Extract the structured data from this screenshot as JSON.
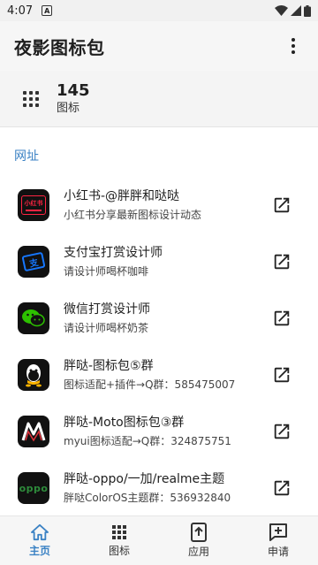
{
  "status_bar": {
    "time": "4:07",
    "notification_glyph": "A"
  },
  "app_bar": {
    "title": "夜影图标包"
  },
  "count_card": {
    "value": "145",
    "label": "图标"
  },
  "section": {
    "title": "网址"
  },
  "links": [
    {
      "title": "小红书-@胖胖和哒哒",
      "subtitle": "小红书分享最新图标设计动态",
      "icon": "xiaohongshu-icon",
      "badge_text": "小红书"
    },
    {
      "title": "支付宝打赏设计师",
      "subtitle": "请设计师喝杯咖啡",
      "icon": "alipay-icon",
      "badge_text": "支"
    },
    {
      "title": "微信打赏设计师",
      "subtitle": "请设计师喝杯奶茶",
      "icon": "wechat-icon"
    },
    {
      "title": "胖哒-图标包⑤群",
      "subtitle": "图标适配+插件→Q群：585475007",
      "icon": "qq-icon"
    },
    {
      "title": "胖哒-Moto图标包③群",
      "subtitle": "myui图标适配→Q群：324875751",
      "icon": "moto-icon"
    },
    {
      "title": "胖哒-oppo/一加/realme主题",
      "subtitle": "胖哒ColorOS主题群：536932840",
      "icon": "oppo-icon",
      "badge_text": "oppo"
    }
  ],
  "bottom_nav": {
    "home": "主页",
    "icons": "图标",
    "apps": "应用",
    "request": "申请"
  },
  "colors": {
    "accent": "#3b82c4",
    "wechat_green": "#2dc100",
    "alipay_blue": "#1677ff",
    "xhs_red": "#ff2442",
    "oppo_green": "#2e8b3b"
  }
}
